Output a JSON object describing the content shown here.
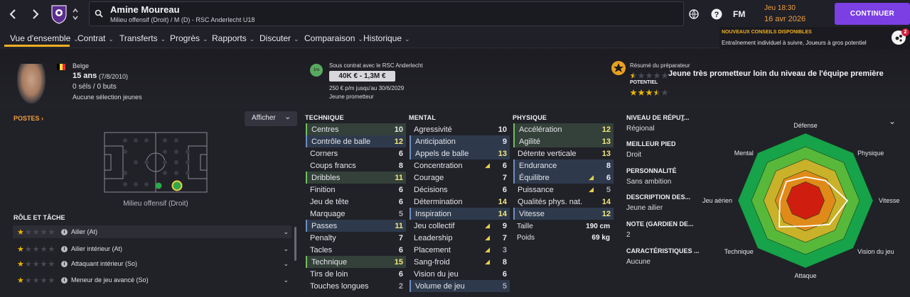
{
  "topbar": {
    "back_icon": "chevron-left-icon",
    "forward_icon": "chevron-right-icon",
    "player_name": "Amine Moureau",
    "player_subtitle": "Milieu offensif (Droit) / M (D) - RSC Anderlecht U18",
    "time": "Jeu 18:30",
    "date": "16 avr 2026",
    "fm_label": "FM",
    "continue_label": "CONTINUER",
    "accent": "#7b3fe4",
    "date_color": "#f0a040"
  },
  "nav": {
    "tabs": [
      {
        "label": "Vue d'ensemble"
      },
      {
        "label": "Contrat"
      },
      {
        "label": "Transferts"
      },
      {
        "label": "Progrès"
      },
      {
        "label": "Rapports"
      },
      {
        "label": "Discuter"
      },
      {
        "label": "Comparaison"
      },
      {
        "label": "Historique"
      }
    ]
  },
  "notification": {
    "title": "NOUVEAUX CONSEILS DISPONIBLES",
    "text": "Entraînement individuel à suivre, Joueurs à gros potentiel",
    "count": "2",
    "title_color": "#f0b020"
  },
  "profile": {
    "nationality": "Belge",
    "age": "15 ans",
    "dob": "(7/8/2010)",
    "caps": "0 séls / 0 buts",
    "youth": "Aucune sélection jeunes"
  },
  "contract": {
    "status": "Sous contrat avec le RSC Anderlecht",
    "value": "40K € - 1,3M €",
    "wage": "250 € p/m jusqu'au 30/6/2029",
    "type": "Jeune prometteur",
    "badge": "1re"
  },
  "scout": {
    "title": "Résumé du préparateur",
    "summary": "Jeune très prometteur loin du niveau de l'équipe première",
    "potential_label": "POTENTIEL",
    "ability_stars": 0.5,
    "potential_stars": 3.5
  },
  "positions": {
    "title": "POSTES",
    "afficher": "Afficher",
    "caption": "Milieu offensif (Droit)"
  },
  "roles": {
    "title": "RÔLE ET TÂCHE",
    "items": [
      {
        "name": "Ailier (At)",
        "stars": 1
      },
      {
        "name": "Ailier intérieur (At)",
        "stars": 1
      },
      {
        "name": "Attaquant intérieur (So)",
        "stars": 1
      },
      {
        "name": "Meneur de jeu avancé (So)",
        "stars": 1
      }
    ]
  },
  "technique": {
    "title": "TECHNIQUE",
    "attrs": [
      {
        "name": "Centres",
        "value": "10",
        "hl": "green"
      },
      {
        "name": "Contrôle de balle",
        "value": "12",
        "hl": "blue"
      },
      {
        "name": "Corners",
        "value": "6",
        "hl": ""
      },
      {
        "name": "Coups francs",
        "value": "8",
        "hl": ""
      },
      {
        "name": "Dribbles",
        "value": "11",
        "hl": "green"
      },
      {
        "name": "Finition",
        "value": "6",
        "hl": ""
      },
      {
        "name": "Jeu de tête",
        "value": "6",
        "hl": ""
      },
      {
        "name": "Marquage",
        "value": "5",
        "hl": ""
      },
      {
        "name": "Passes",
        "value": "11",
        "hl": "blue"
      },
      {
        "name": "Penalty",
        "value": "7",
        "hl": ""
      },
      {
        "name": "Tacles",
        "value": "6",
        "hl": ""
      },
      {
        "name": "Technique",
        "value": "15",
        "hl": "green"
      },
      {
        "name": "Tirs de loin",
        "value": "6",
        "hl": ""
      },
      {
        "name": "Touches longues",
        "value": "2",
        "hl": ""
      }
    ]
  },
  "mental": {
    "title": "MENTAL",
    "attrs": [
      {
        "name": "Agressivité",
        "value": "10",
        "hl": "",
        "arrow": false
      },
      {
        "name": "Anticipation",
        "value": "9",
        "hl": "blue",
        "arrow": false
      },
      {
        "name": "Appels de balle",
        "value": "13",
        "hl": "blue",
        "arrow": false
      },
      {
        "name": "Concentration",
        "value": "6",
        "hl": "",
        "arrow": true
      },
      {
        "name": "Courage",
        "value": "7",
        "hl": "",
        "arrow": false
      },
      {
        "name": "Décisions",
        "value": "6",
        "hl": "",
        "arrow": false
      },
      {
        "name": "Détermination",
        "value": "14",
        "hl": "",
        "arrow": false
      },
      {
        "name": "Inspiration",
        "value": "14",
        "hl": "blue",
        "arrow": false
      },
      {
        "name": "Jeu collectif",
        "value": "9",
        "hl": "",
        "arrow": true
      },
      {
        "name": "Leadership",
        "value": "7",
        "hl": "",
        "arrow": true
      },
      {
        "name": "Placement",
        "value": "3",
        "hl": "",
        "arrow": true
      },
      {
        "name": "Sang-froid",
        "value": "8",
        "hl": "",
        "arrow": true
      },
      {
        "name": "Vision du jeu",
        "value": "6",
        "hl": "",
        "arrow": false
      },
      {
        "name": "Volume de jeu",
        "value": "5",
        "hl": "blue",
        "arrow": false
      }
    ]
  },
  "physique": {
    "title": "PHYSIQUE",
    "attrs": [
      {
        "name": "Accélération",
        "value": "12",
        "hl": "green",
        "arrow": false
      },
      {
        "name": "Agilité",
        "value": "13",
        "hl": "green",
        "arrow": false
      },
      {
        "name": "Détente verticale",
        "value": "13",
        "hl": "",
        "arrow": false
      },
      {
        "name": "Endurance",
        "value": "8",
        "hl": "blue",
        "arrow": false
      },
      {
        "name": "Équilibre",
        "value": "6",
        "hl": "blue",
        "arrow": true
      },
      {
        "name": "Puissance",
        "value": "5",
        "hl": "",
        "arrow": true
      },
      {
        "name": "Qualités phys. nat.",
        "value": "14",
        "hl": "",
        "arrow": false
      },
      {
        "name": "Vitesse",
        "value": "12",
        "hl": "blue",
        "arrow": false
      }
    ],
    "height_label": "Taille",
    "height": "190 cm",
    "weight_label": "Poids",
    "weight": "69 kg"
  },
  "info": {
    "items": [
      {
        "label": "NIVEAU DE RÉPUT...",
        "value": "Régional"
      },
      {
        "label": "MEILLEUR PIED",
        "value": "Droit"
      },
      {
        "label": "PERSONNALITÉ",
        "value": "Sans ambition"
      },
      {
        "label": "DESCRIPTION DES...",
        "value": "Jeune ailier"
      },
      {
        "label": "NOTE (GARDIEN DE...",
        "value": "2"
      },
      {
        "label": "CARACTÉRISTIQUES ...",
        "value": "Aucune"
      }
    ]
  },
  "radar": {
    "axes": [
      "Défense",
      "Physique",
      "Vitesse",
      "Vision du jeu",
      "Attaque",
      "Technique",
      "Jeu aérien",
      "Mental"
    ],
    "values": [
      0.35,
      0.42,
      0.62,
      0.5,
      0.38,
      0.55,
      0.38,
      0.4
    ]
  }
}
